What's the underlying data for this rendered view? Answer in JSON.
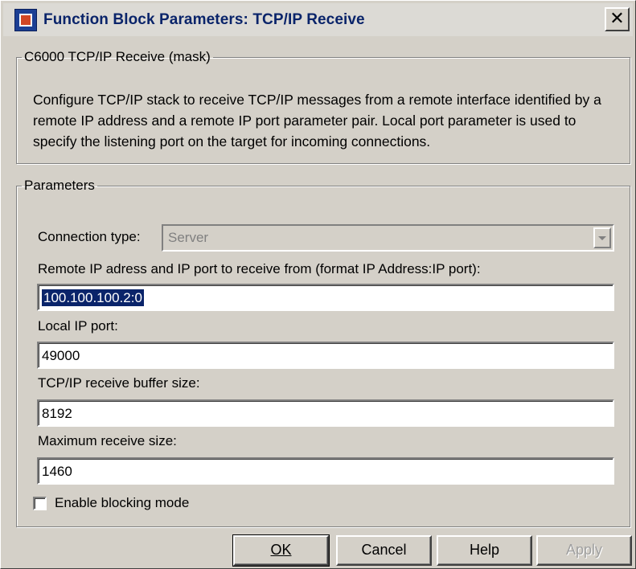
{
  "window": {
    "title": "Function Block Parameters: TCP/IP Receive",
    "close_glyph": "✕"
  },
  "mask": {
    "legend": "C6000 TCP/IP Receive (mask)",
    "description": "Configure TCP/IP stack  to receive TCP/IP messages from a remote interface identified by a remote  IP address and a remote IP port parameter pair. Local port parameter is used to specify the listening port on the target for incoming connections."
  },
  "parameters": {
    "legend": "Parameters",
    "connection_type": {
      "label": "Connection type:",
      "value": "Server"
    },
    "remote_ip": {
      "label": "Remote IP adress and IP port to receive from (format IP Address:IP port):",
      "value": "100.100.100.2:0"
    },
    "local_port": {
      "label": "Local IP port:",
      "value": "49000"
    },
    "buffer_size": {
      "label": "TCP/IP receive buffer size:",
      "value": "8192"
    },
    "max_receive": {
      "label": "Maximum receive size:",
      "value": "1460"
    },
    "blocking": {
      "label": "Enable blocking mode",
      "checked": false
    }
  },
  "buttons": {
    "ok": "OK",
    "cancel": "Cancel",
    "help": "Help",
    "apply": "Apply"
  },
  "icons": {
    "app": "simulink-block-icon",
    "close": "close-icon",
    "dropdown": "chevron-down-icon"
  }
}
